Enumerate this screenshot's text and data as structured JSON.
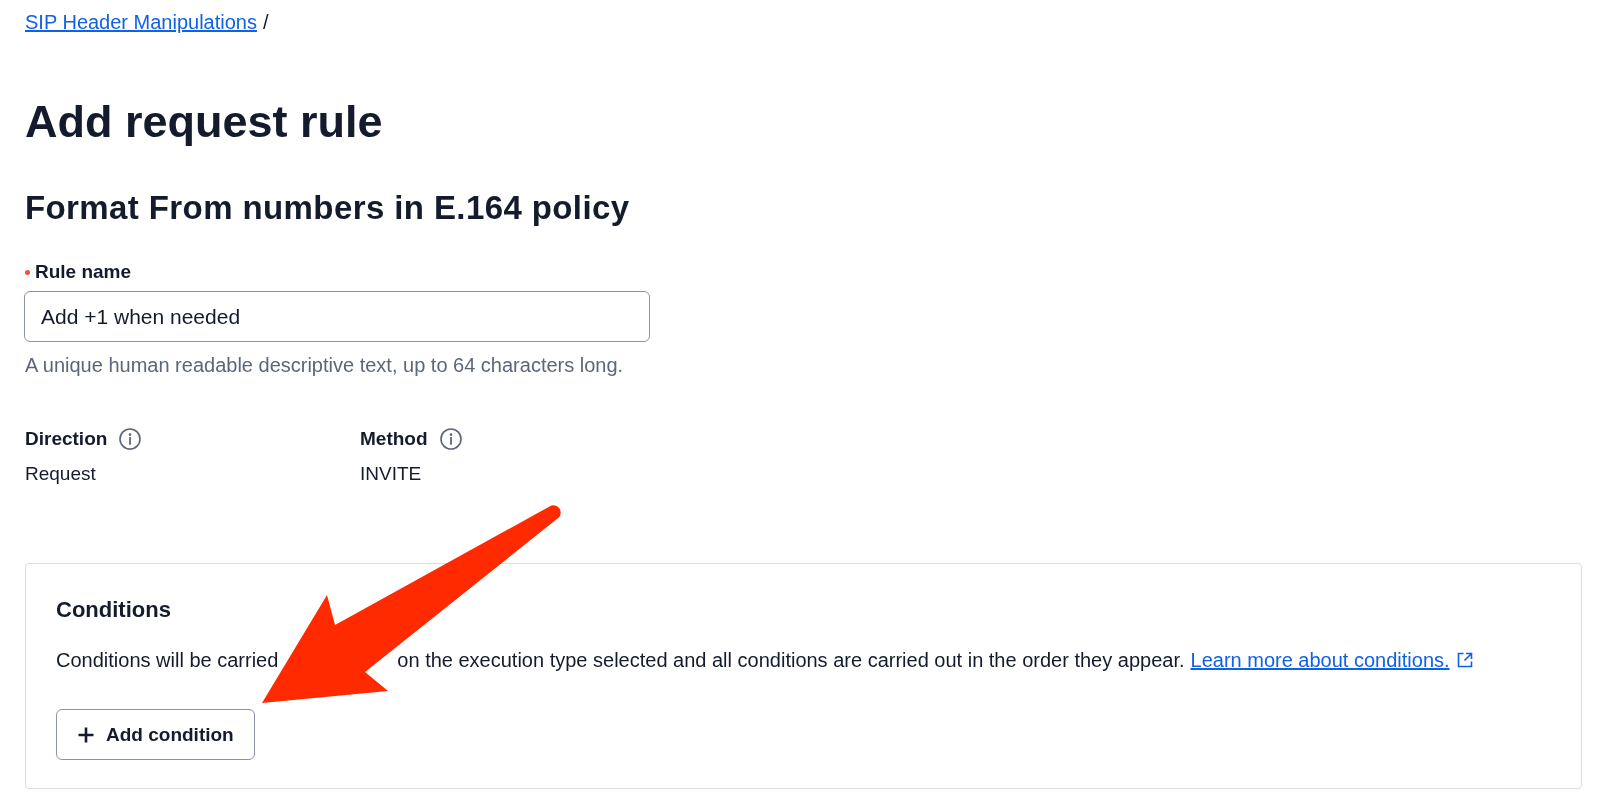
{
  "breadcrumb": {
    "items": [
      {
        "label": "SIP Header Manipulations",
        "kind": "link"
      }
    ],
    "separator": "/"
  },
  "page_title": "Add request rule",
  "policy_title": "Format From numbers in E.164 policy",
  "rule_name_field": {
    "label": "Rule name",
    "required": true,
    "value": "Add +1 when needed",
    "hint": "A unique human readable descriptive text, up to 64 characters long."
  },
  "properties": [
    {
      "label": "Direction",
      "value": "Request"
    },
    {
      "label": "Method",
      "value": "INVITE"
    }
  ],
  "conditions_panel": {
    "title": "Conditions",
    "description_parts": [
      "Conditions will be carried",
      "on the execution type selected and all conditions are carried out in the order they appear."
    ],
    "link": "Learn more about conditions.",
    "button": "Add condition"
  },
  "annotations": [
    {
      "kind": "arrow"
    }
  ]
}
